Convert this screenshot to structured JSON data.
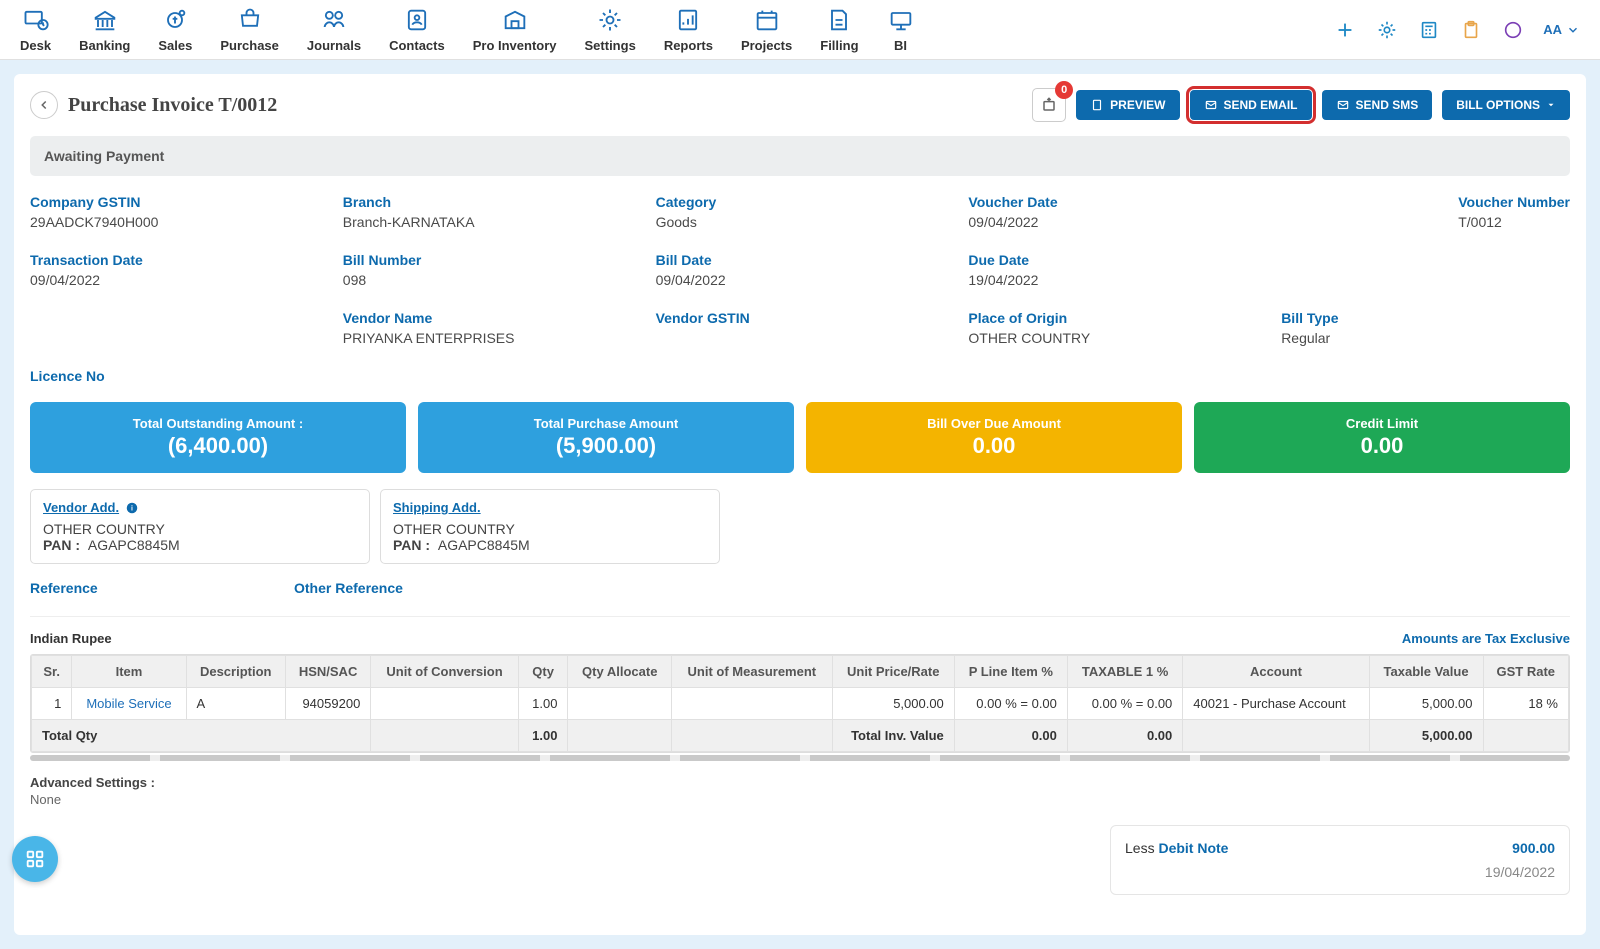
{
  "nav": {
    "items": [
      {
        "label": "Desk"
      },
      {
        "label": "Banking"
      },
      {
        "label": "Sales"
      },
      {
        "label": "Purchase"
      },
      {
        "label": "Journals"
      },
      {
        "label": "Contacts"
      },
      {
        "label": "Pro Inventory"
      },
      {
        "label": "Settings"
      },
      {
        "label": "Reports"
      },
      {
        "label": "Projects"
      },
      {
        "label": "Filling"
      },
      {
        "label": "BI"
      }
    ],
    "font_toggle": "AA"
  },
  "header": {
    "title": "Purchase Invoice T/0012",
    "upload_badge": "0",
    "buttons": {
      "preview": "PREVIEW",
      "send_email": "SEND EMAIL",
      "send_sms": "SEND SMS",
      "bill_options": "BILL OPTIONS"
    }
  },
  "status": "Awaiting Payment",
  "info": {
    "company_gstin_lbl": "Company GSTIN",
    "company_gstin": "29AADCK7940H000",
    "branch_lbl": "Branch",
    "branch": "Branch-KARNATAKA",
    "category_lbl": "Category",
    "category": "Goods",
    "voucher_date_lbl": "Voucher Date",
    "voucher_date": "09/04/2022",
    "transaction_date_lbl": "Transaction Date",
    "transaction_date": "09/04/2022",
    "voucher_no_lbl": "Voucher Number",
    "voucher_no": "T/0012",
    "bill_no_lbl": "Bill Number",
    "bill_no": "098",
    "bill_date_lbl": "Bill Date",
    "bill_date": "09/04/2022",
    "due_date_lbl": "Due Date",
    "due_date": "19/04/2022",
    "vendor_name_lbl": "Vendor Name",
    "vendor_name": "PRIYANKA ENTERPRISES",
    "vendor_gstin_lbl": "Vendor GSTIN",
    "vendor_gstin": "",
    "place_origin_lbl": "Place of Origin",
    "place_origin": "OTHER COUNTRY",
    "bill_type_lbl": "Bill Type",
    "bill_type": "Regular",
    "licence_lbl": "Licence No",
    "licence": ""
  },
  "summary": {
    "outstanding_lbl": "Total Outstanding Amount :",
    "outstanding": "(6,400.00)",
    "purchase_lbl": "Total Purchase Amount",
    "purchase": "(5,900.00)",
    "overdue_lbl": "Bill Over Due Amount",
    "overdue": "0.00",
    "credit_lbl": "Credit Limit",
    "credit": "0.00"
  },
  "addresses": {
    "vendor_title": "Vendor Add.",
    "vendor_line": "OTHER COUNTRY",
    "pan_lbl": "PAN :",
    "vendor_pan": "AGAPC8845M",
    "ship_title": "Shipping Add.",
    "ship_line": "OTHER COUNTRY",
    "ship_pan": "AGAPC8845M"
  },
  "references": {
    "ref_lbl": "Reference",
    "oref_lbl": "Other Reference"
  },
  "currency": {
    "name": "Indian Rupee",
    "tax_note": "Amounts are Tax Exclusive"
  },
  "table": {
    "headers": [
      "Sr.",
      "Item",
      "Description",
      "HSN/SAC",
      "Unit of Conversion",
      "Qty",
      "Qty Allocate",
      "Unit of Measurement",
      "Unit Price/Rate",
      "P Line Item %",
      "TAXABLE 1 %",
      "Account",
      "Taxable Value",
      "GST Rate"
    ],
    "row": {
      "sr": "1",
      "item": "Mobile Service",
      "desc": "A",
      "hsn": "94059200",
      "uoc": "",
      "qty": "1.00",
      "qtya": "",
      "uom": "",
      "rate": "5,000.00",
      "pline": "0.00 % = 0.00",
      "tax1": "0.00 % = 0.00",
      "account": "40021 - Purchase Account",
      "taxval": "5,000.00",
      "gst": "18 %"
    },
    "footer": {
      "total_qty_lbl": "Total Qty",
      "total_qty": "1.00",
      "total_inv_lbl": "Total Inv. Value",
      "pline_sum": "0.00",
      "tax1_sum": "0.00",
      "taxval_sum": "5,000.00"
    }
  },
  "advanced": {
    "title": "Advanced Settings :",
    "value": "None"
  },
  "totals": {
    "less_lbl": "Less ",
    "debit_link": "Debit Note",
    "debit_val": "900.00",
    "date_val": "19/04/2022"
  }
}
